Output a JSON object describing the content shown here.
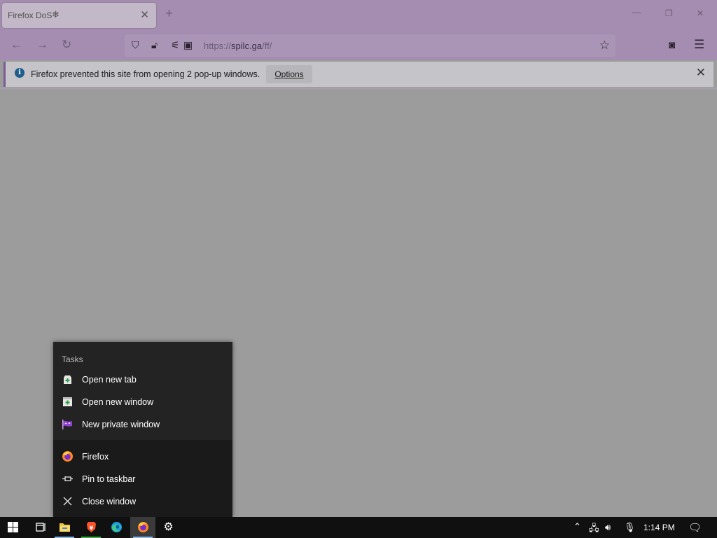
{
  "browser": {
    "tab": {
      "title": "Firefox DoS",
      "icon": "snowflake-icon"
    },
    "url": {
      "scheme": "https://",
      "host": "spilc.ga",
      "path": "/ff/"
    },
    "notification": {
      "message": "Firefox prevented this site from opening 2 pop-up windows.",
      "options_label": "Options"
    }
  },
  "jumplist": {
    "tasks_header": "Tasks",
    "tasks": [
      {
        "label": "Open new tab",
        "icon": "new-tab-icon"
      },
      {
        "label": "Open new window",
        "icon": "new-window-icon"
      },
      {
        "label": "New private window",
        "icon": "private-window-icon"
      }
    ],
    "actions": [
      {
        "label": "Firefox",
        "icon": "firefox-icon"
      },
      {
        "label": "Pin to taskbar",
        "icon": "pin-icon"
      },
      {
        "label": "Close window",
        "icon": "close-icon"
      }
    ]
  },
  "taskbar": {
    "clock": "1:14 PM",
    "apps": [
      "windows-start",
      "task-view",
      "file-explorer",
      "brave",
      "edge",
      "firefox",
      "settings"
    ]
  },
  "colors": {
    "chrome": "#a48db0",
    "jumplist_bg": "#232323",
    "taskbar_bg": "#101010",
    "accent": "#8ab6e8"
  }
}
